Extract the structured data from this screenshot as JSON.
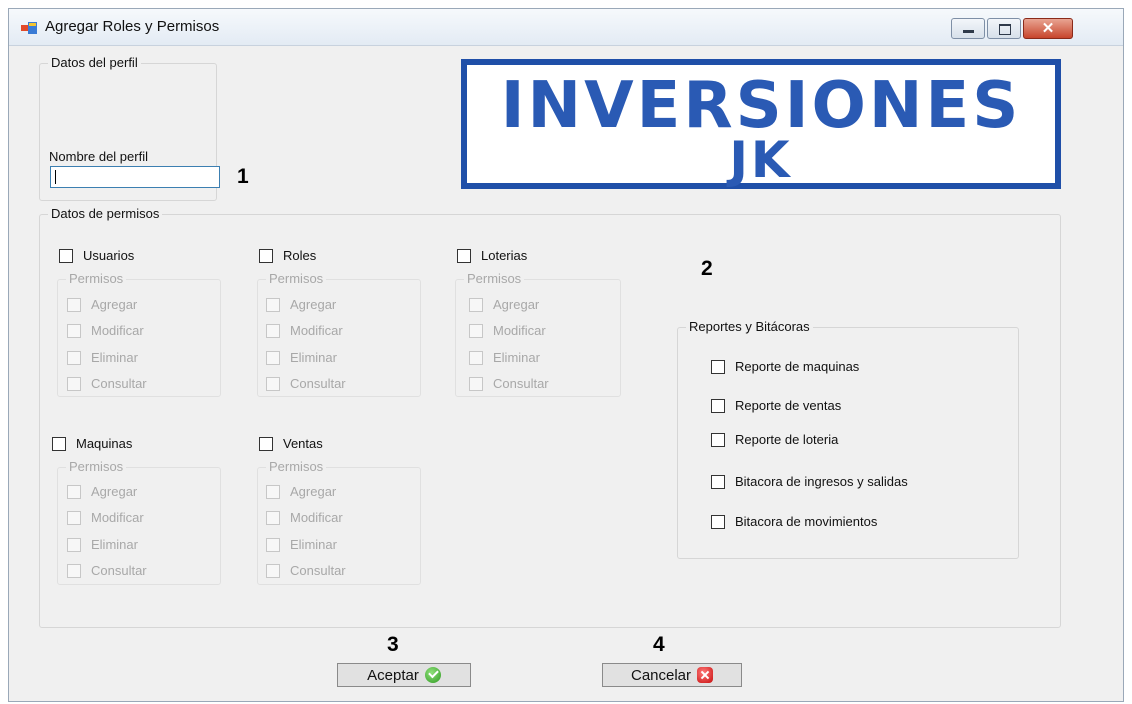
{
  "window": {
    "title": "Agregar Roles y Permisos",
    "close_glyph": "✕"
  },
  "profile": {
    "group_label": "Datos del perfil",
    "name_label": "Nombre del perfil",
    "name_value": ""
  },
  "logo": {
    "line1": "INVERSIONES",
    "line2": "JK"
  },
  "annotations": {
    "n1": "1",
    "n2": "2",
    "n3": "3",
    "n4": "4"
  },
  "permissions": {
    "group_label": "Datos de permisos",
    "sub_label": "Permisos",
    "actions": [
      "Agregar",
      "Modificar",
      "Eliminar",
      "Consultar"
    ],
    "modules": [
      "Usuarios",
      "Roles",
      "Loterias",
      "Maquinas",
      "Ventas"
    ]
  },
  "reports": {
    "group_label": "Reportes y Bitácoras",
    "items": [
      "Reporte de maquinas",
      "Reporte de ventas",
      "Reporte de loteria",
      "Bitacora de ingresos y salidas",
      "Bitacora de movimientos"
    ]
  },
  "buttons": {
    "accept": "Aceptar",
    "cancel": "Cancelar"
  }
}
